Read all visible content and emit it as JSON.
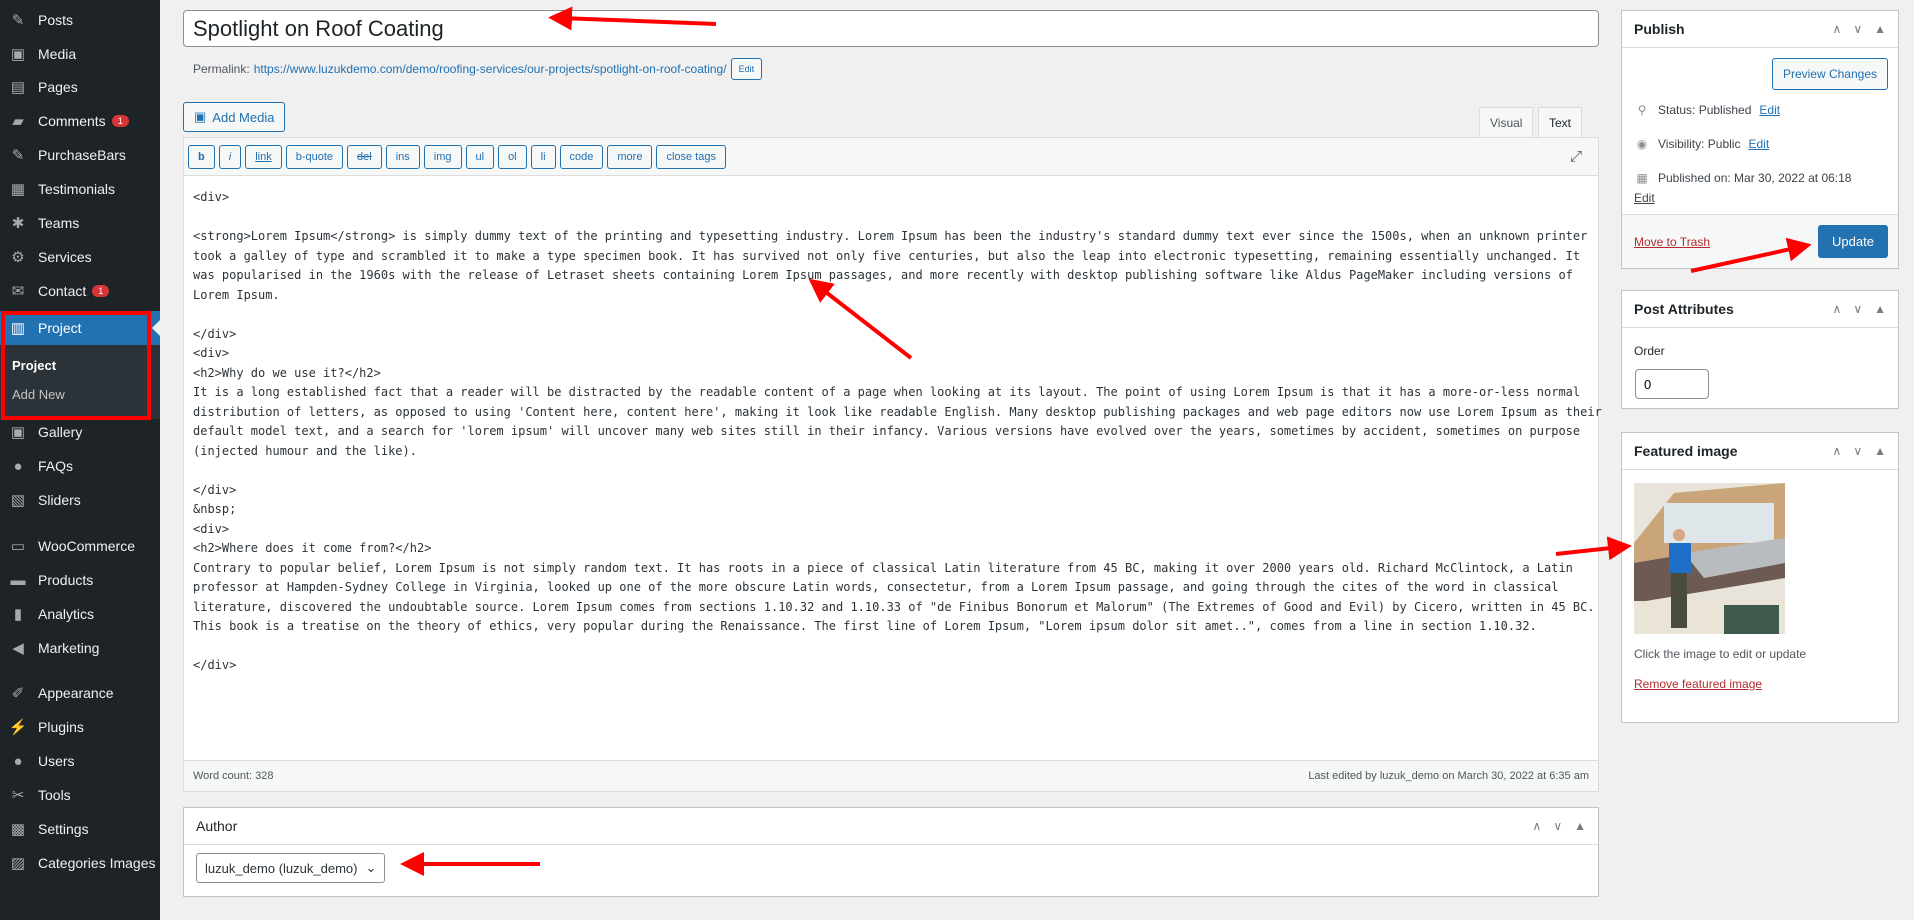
{
  "sidebar": {
    "items": [
      {
        "label": "Posts",
        "icon": "pin-icon",
        "glyph": "✎"
      },
      {
        "label": "Media",
        "icon": "media-icon",
        "glyph": "▣"
      },
      {
        "label": "Pages",
        "icon": "pages-icon",
        "glyph": "▤"
      },
      {
        "label": "Comments",
        "icon": "comment-icon",
        "glyph": "▰",
        "badge": "1"
      },
      {
        "label": "PurchaseBars",
        "icon": "pin-icon",
        "glyph": "✎"
      },
      {
        "label": "Testimonials",
        "icon": "testimonials-icon",
        "glyph": "▦"
      },
      {
        "label": "Teams",
        "icon": "teams-icon",
        "glyph": "✱"
      },
      {
        "label": "Services",
        "icon": "services-icon",
        "glyph": "⚙"
      },
      {
        "label": "Contact",
        "icon": "mail-icon",
        "glyph": "✉",
        "badge": "1"
      },
      {
        "label": "Project",
        "icon": "project-icon",
        "glyph": "▥",
        "active": true
      },
      {
        "label": "Gallery",
        "icon": "gallery-icon",
        "glyph": "▣"
      },
      {
        "label": "FAQs",
        "icon": "chat-icon",
        "glyph": "●"
      },
      {
        "label": "Sliders",
        "icon": "sliders-icon",
        "glyph": "▧"
      },
      {
        "label": "WooCommerce",
        "icon": "woo-icon",
        "glyph": "▭"
      },
      {
        "label": "Products",
        "icon": "products-icon",
        "glyph": "▬"
      },
      {
        "label": "Analytics",
        "icon": "analytics-icon",
        "glyph": "▮"
      },
      {
        "label": "Marketing",
        "icon": "megaphone-icon",
        "glyph": "◀"
      },
      {
        "label": "Appearance",
        "icon": "brush-icon",
        "glyph": "✐"
      },
      {
        "label": "Plugins",
        "icon": "plug-icon",
        "glyph": "⚡"
      },
      {
        "label": "Users",
        "icon": "user-icon",
        "glyph": "●"
      },
      {
        "label": "Tools",
        "icon": "wrench-icon",
        "glyph": "✂"
      },
      {
        "label": "Settings",
        "icon": "settings-icon",
        "glyph": "▩"
      },
      {
        "label": "Categories Images",
        "icon": "image-icon",
        "glyph": "▨"
      }
    ],
    "submenu": [
      "Project",
      "Add New"
    ]
  },
  "post": {
    "title": "Spotlight on Roof Coating",
    "permalink_label": "Permalink:",
    "permalink_url": "https://www.luzukdemo.com/demo/roofing-services/our-projects/spotlight-on-roof-coating/",
    "permalink_edit": "Edit"
  },
  "editor": {
    "add_media": "Add Media",
    "tabs": [
      "Visual",
      "Text"
    ],
    "active_tab": "Text",
    "quicktags": [
      "b",
      "i",
      "link",
      "b-quote",
      "del",
      "ins",
      "img",
      "ul",
      "ol",
      "li",
      "code",
      "more",
      "close tags"
    ],
    "lines": [
      "<div>",
      "",
      "<strong>Lorem Ipsum</strong> is simply dummy text of the printing and typesetting industry. Lorem Ipsum has been the industry's standard dummy text ever since the 1500s, when an unknown printer",
      "took a galley of type and scrambled it to make a type specimen book. It has survived not only five centuries, but also the leap into electronic typesetting, remaining essentially unchanged. It",
      "was popularised in the 1960s with the release of Letraset sheets containing Lorem Ipsum passages, and more recently with desktop publishing software like Aldus PageMaker including versions of",
      "Lorem Ipsum.",
      "",
      "</div>",
      "<div>",
      "<h2>Why do we use it?</h2>",
      "It is a long established fact that a reader will be distracted by the readable content of a page when looking at its layout. The point of using Lorem Ipsum is that it has a more-or-less normal",
      "distribution of letters, as opposed to using 'Content here, content here', making it look like readable English. Many desktop publishing packages and web page editors now use Lorem Ipsum as their",
      "default model text, and a search for 'lorem ipsum' will uncover many web sites still in their infancy. Various versions have evolved over the years, sometimes by accident, sometimes on purpose",
      "(injected humour and the like).",
      "",
      "</div>",
      "&nbsp;",
      "<div>",
      "<h2>Where does it come from?</h2>",
      "Contrary to popular belief, Lorem Ipsum is not simply random text. It has roots in a piece of classical Latin literature from 45 BC, making it over 2000 years old. Richard McClintock, a Latin",
      "professor at Hampden-Sydney College in Virginia, looked up one of the more obscure Latin words, consectetur, from a Lorem Ipsum passage, and going through the cites of the word in classical",
      "literature, discovered the undoubtable source. Lorem Ipsum comes from sections 1.10.32 and 1.10.33 of \"de Finibus Bonorum et Malorum\" (The Extremes of Good and Evil) by Cicero, written in 45 BC.",
      "This book is a treatise on the theory of ethics, very popular during the Renaissance. The first line of Lorem Ipsum, \"Lorem ipsum dolor sit amet..\", comes from a line in section 1.10.32.",
      "",
      "</div>"
    ],
    "word_count": "Word count: 328",
    "last_edited": "Last edited by luzuk_demo on March 30, 2022 at 6:35 am"
  },
  "author": {
    "title": "Author",
    "selected": "luzuk_demo (luzuk_demo)"
  },
  "publish": {
    "title": "Publish",
    "preview": "Preview Changes",
    "status_label": "Status: Published",
    "visibility_label": "Visibility: Public",
    "published_label": "Published on: Mar 30, 2022 at 06:18",
    "edit": "Edit",
    "trash": "Move to Trash",
    "update": "Update"
  },
  "attributes": {
    "title": "Post Attributes",
    "order_label": "Order",
    "order_value": "0"
  },
  "featured": {
    "title": "Featured image",
    "hint": "Click the image to edit or update",
    "remove": "Remove featured image"
  },
  "colors": {
    "accent": "#2271b1",
    "annotation": "#ff0000",
    "sidebar": "#1d2327",
    "danger": "#d63638"
  }
}
